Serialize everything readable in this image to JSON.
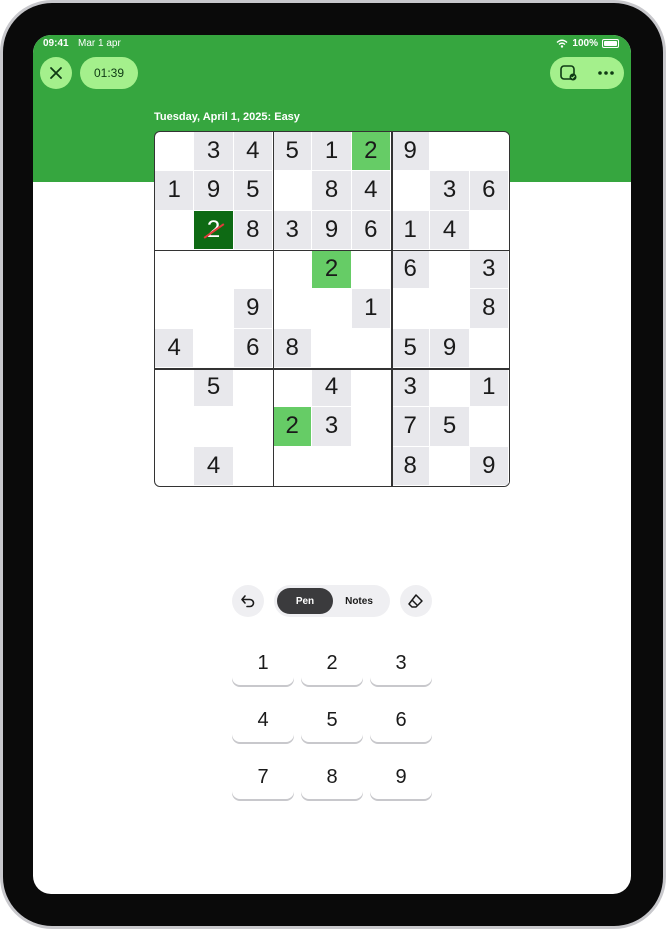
{
  "status": {
    "time": "09:41",
    "date": "Mar 1 apr",
    "battery": "100%"
  },
  "header": {
    "close_icon": "close-icon",
    "timer": "01:39",
    "check_icon": "check-square-icon",
    "more_icon": "more-icon",
    "puzzle_title": "Tuesday, April 1, 2025: Easy"
  },
  "grid": {
    "rows": [
      [
        "",
        "3",
        "4",
        "5",
        "1",
        "2",
        "9",
        "",
        ""
      ],
      [
        "1",
        "9",
        "5",
        "",
        "8",
        "4",
        "",
        "3",
        "6"
      ],
      [
        "",
        "2",
        "8",
        "3",
        "9",
        "6",
        "1",
        "4",
        ""
      ],
      [
        "",
        "",
        "",
        "",
        "2",
        "",
        "6",
        "",
        "3"
      ],
      [
        "",
        "",
        "9",
        "",
        "",
        "1",
        "",
        "",
        "8"
      ],
      [
        "4",
        "",
        "6",
        "8",
        "",
        "",
        "5",
        "9",
        ""
      ],
      [
        "",
        "5",
        "",
        "",
        "4",
        "",
        "3",
        "",
        "1"
      ],
      [
        "",
        "",
        "",
        "2",
        "3",
        "",
        "7",
        "5",
        ""
      ],
      [
        "",
        "4",
        "",
        "",
        "",
        "",
        "8",
        "",
        "9"
      ]
    ],
    "selected_cell": [
      2,
      1
    ],
    "error_cell": [
      2,
      1
    ],
    "highlighted_cells": [
      [
        0,
        5
      ],
      [
        3,
        4
      ],
      [
        7,
        3
      ]
    ],
    "colors": {
      "header": "#36a63f",
      "highlight": "#66cc66",
      "selected": "#0e6a14",
      "shade": "#e8e8ec"
    }
  },
  "toolbar": {
    "undo_icon": "undo-icon",
    "pen_label": "Pen",
    "notes_label": "Notes",
    "eraser_icon": "eraser-icon"
  },
  "keypad": {
    "keys": [
      "1",
      "2",
      "3",
      "4",
      "5",
      "6",
      "7",
      "8",
      "9"
    ]
  }
}
